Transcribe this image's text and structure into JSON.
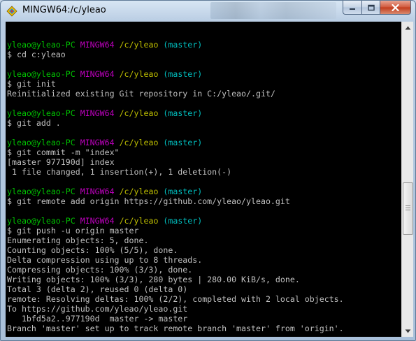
{
  "window": {
    "title": "MINGW64:/c/yleao"
  },
  "console": {
    "lines": [
      [],
      [
        {
          "t": "yleao@yleao-PC",
          "c": "user"
        },
        {
          "t": " "
        },
        {
          "t": "MINGW64",
          "c": "sys"
        },
        {
          "t": " "
        },
        {
          "t": "/c/yleao",
          "c": "path"
        },
        {
          "t": " "
        },
        {
          "t": "(master)",
          "c": "branch"
        }
      ],
      [
        {
          "t": "$ cd c:yleao"
        }
      ],
      [],
      [
        {
          "t": "yleao@yleao-PC",
          "c": "user"
        },
        {
          "t": " "
        },
        {
          "t": "MINGW64",
          "c": "sys"
        },
        {
          "t": " "
        },
        {
          "t": "/c/yleao",
          "c": "path"
        },
        {
          "t": " "
        },
        {
          "t": "(master)",
          "c": "branch"
        }
      ],
      [
        {
          "t": "$ git init"
        }
      ],
      [
        {
          "t": "Reinitialized existing Git repository in C:/yleao/.git/"
        }
      ],
      [],
      [
        {
          "t": "yleao@yleao-PC",
          "c": "user"
        },
        {
          "t": " "
        },
        {
          "t": "MINGW64",
          "c": "sys"
        },
        {
          "t": " "
        },
        {
          "t": "/c/yleao",
          "c": "path"
        },
        {
          "t": " "
        },
        {
          "t": "(master)",
          "c": "branch"
        }
      ],
      [
        {
          "t": "$ git add ."
        }
      ],
      [],
      [
        {
          "t": "yleao@yleao-PC",
          "c": "user"
        },
        {
          "t": " "
        },
        {
          "t": "MINGW64",
          "c": "sys"
        },
        {
          "t": " "
        },
        {
          "t": "/c/yleao",
          "c": "path"
        },
        {
          "t": " "
        },
        {
          "t": "(master)",
          "c": "branch"
        }
      ],
      [
        {
          "t": "$ git commit -m \"index\""
        }
      ],
      [
        {
          "t": "[master 977190d] index"
        }
      ],
      [
        {
          "t": " 1 file changed, 1 insertion(+), 1 deletion(-)"
        }
      ],
      [],
      [
        {
          "t": "yleao@yleao-PC",
          "c": "user"
        },
        {
          "t": " "
        },
        {
          "t": "MINGW64",
          "c": "sys"
        },
        {
          "t": " "
        },
        {
          "t": "/c/yleao",
          "c": "path"
        },
        {
          "t": " "
        },
        {
          "t": "(master)",
          "c": "branch"
        }
      ],
      [
        {
          "t": "$ git remote add origin https://github.com/yleao/yleao.git"
        }
      ],
      [],
      [
        {
          "t": "yleao@yleao-PC",
          "c": "user"
        },
        {
          "t": " "
        },
        {
          "t": "MINGW64",
          "c": "sys"
        },
        {
          "t": " "
        },
        {
          "t": "/c/yleao",
          "c": "path"
        },
        {
          "t": " "
        },
        {
          "t": "(master)",
          "c": "branch"
        }
      ],
      [
        {
          "t": "$ git push -u origin master"
        }
      ],
      [
        {
          "t": "Enumerating objects: 5, done."
        }
      ],
      [
        {
          "t": "Counting objects: 100% (5/5), done."
        }
      ],
      [
        {
          "t": "Delta compression using up to 8 threads."
        }
      ],
      [
        {
          "t": "Compressing objects: 100% (3/3), done."
        }
      ],
      [
        {
          "t": "Writing objects: 100% (3/3), 280 bytes | 280.00 KiB/s, done."
        }
      ],
      [
        {
          "t": "Total 3 (delta 2), reused 0 (delta 0)"
        }
      ],
      [
        {
          "t": "remote: Resolving deltas: 100% (2/2), completed with 2 local objects."
        }
      ],
      [
        {
          "t": "To https://github.com/yleao/yleao.git"
        }
      ],
      [
        {
          "t": "   1bfd5a2..977190d  master -> master"
        }
      ],
      [
        {
          "t": "Branch 'master' set up to track remote branch 'master' from 'origin'."
        }
      ]
    ]
  },
  "colors": {
    "background": "#000000",
    "text": "#c0c0c0",
    "user": "#00bf00",
    "sys": "#bf00bf",
    "path": "#bfbf00",
    "branch": "#00bfbf"
  },
  "scrollbar": {
    "position_fraction": 0.62
  },
  "icons": {
    "app": "mingw-app-icon",
    "minimize": "minimize-icon",
    "maximize": "maximize-icon",
    "close": "close-icon",
    "scroll_up": "scroll-up-arrow-icon",
    "scroll_down": "scroll-down-arrow-icon"
  }
}
